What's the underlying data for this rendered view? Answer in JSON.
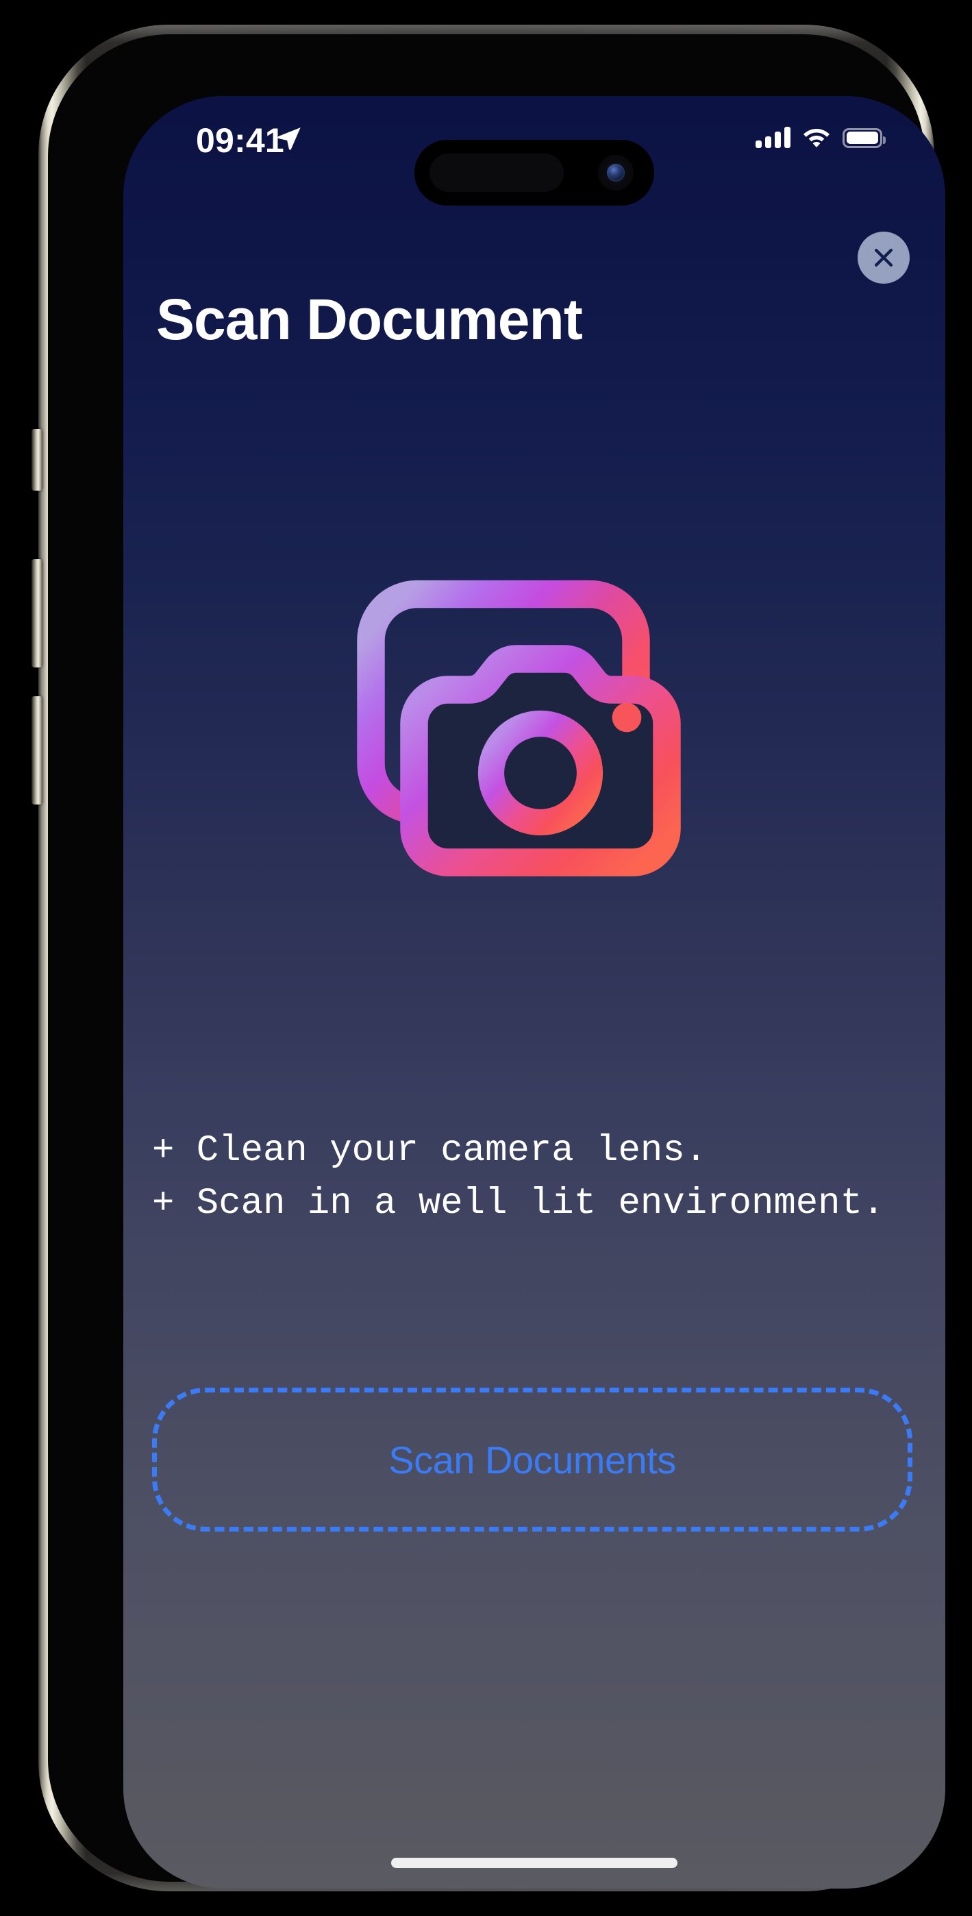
{
  "status_bar": {
    "time": "09:41",
    "location_icon": "location-arrow-icon",
    "cellular_icon": "cellular-signal-icon",
    "cellular_bars_filled": 4,
    "wifi_icon": "wifi-icon",
    "battery_icon": "battery-icon",
    "battery_level_percent": 90
  },
  "header": {
    "title": "Scan Document",
    "close_label": "Close",
    "close_icon": "close-x-icon"
  },
  "hero": {
    "icon": "document-camera-icon",
    "gradient_start": "#b08ce8",
    "gradient_mid": "#c04ae0",
    "gradient_end": "#f8504e"
  },
  "instructions": {
    "lines": [
      "+ Clean your camera lens.",
      "+ Scan in a well lit environment."
    ],
    "text": "+ Clean your camera lens.\n+ Scan in a well lit environment."
  },
  "primary_action": {
    "label": "Scan Documents",
    "accent_color": "#3b7bf5",
    "border_style": "dashed"
  },
  "system": {
    "home_indicator": "home-indicator-bar"
  },
  "theme": {
    "background_top": "#0c1244",
    "background_bottom": "#5a5a62",
    "title_color": "#ffffff",
    "instruction_color": "#ffffff",
    "close_button_color": "#96a0bf"
  },
  "device": {
    "action_button": "action-button",
    "volume_up_button": "volume-up-button",
    "volume_down_button": "volume-down-button",
    "power_button": "power-button"
  }
}
